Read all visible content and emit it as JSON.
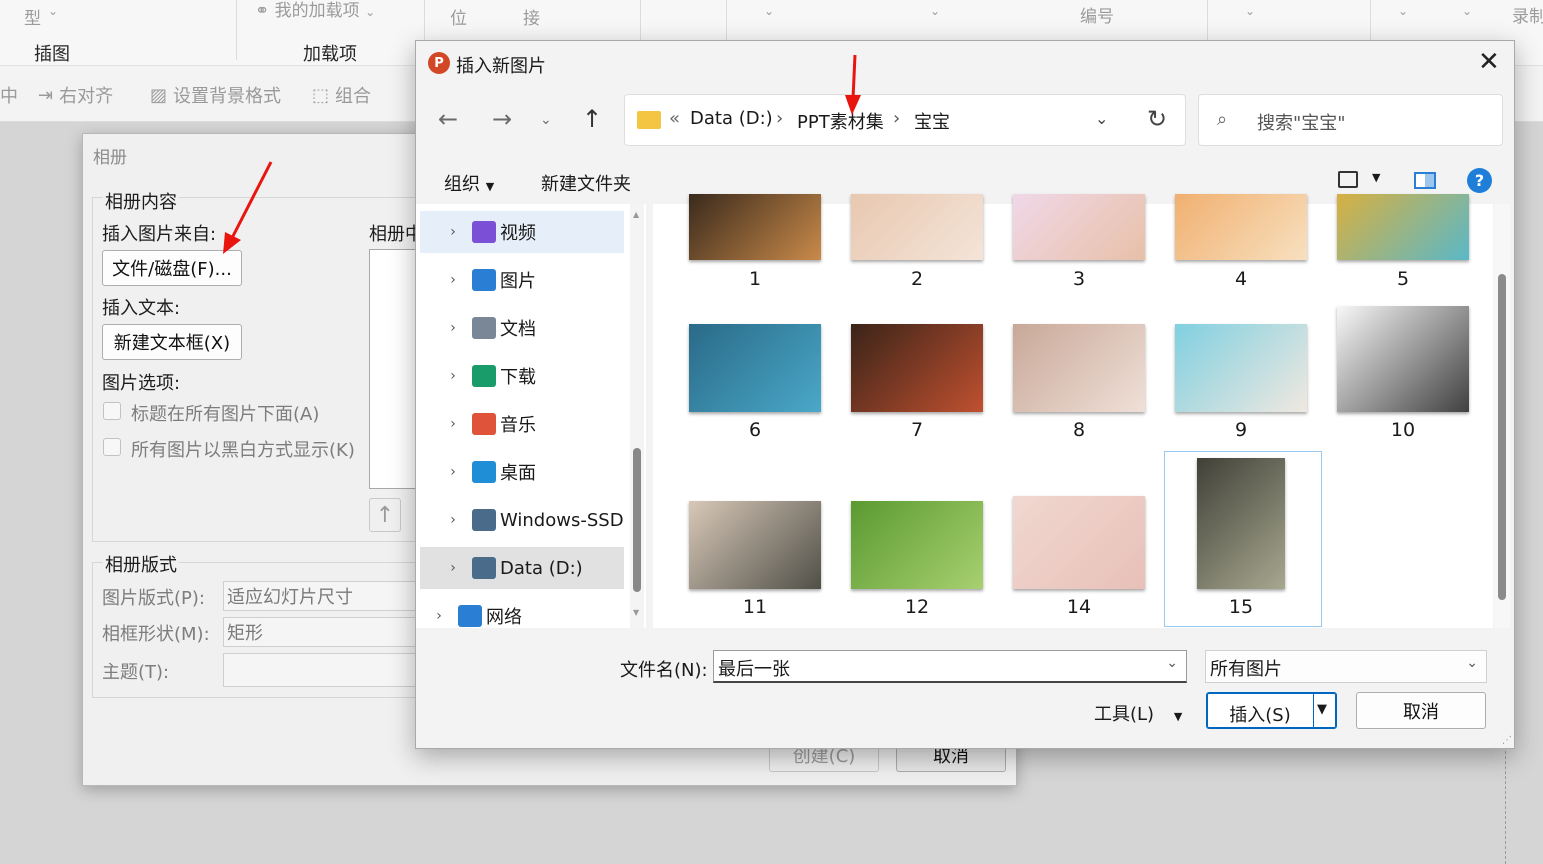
{
  "ribbon": {
    "top_faded": [
      "型",
      "我的加载项",
      "位",
      "接",
      "编号",
      "录制"
    ],
    "groups": {
      "insert_graphic": "插图",
      "addins": "加载项"
    },
    "toolbar": {
      "cut_partial": "中",
      "align_right": "右对齐",
      "bg_format": "设置背景格式",
      "group": "组合"
    }
  },
  "album_dialog": {
    "title": "相册",
    "content_group": "相册内容",
    "insert_from": "插入图片来自:",
    "file_disk_button": "文件/磁盘(F)...",
    "insert_text": "插入文本:",
    "new_textbox_button": "新建文本框(X)",
    "picture_options": "图片选项:",
    "option_caption": "标题在所有图片下面(A)",
    "option_bw": "所有图片以黑白方式显示(K)",
    "pictures_in_album": "相册中",
    "layout_group": "相册版式",
    "picture_layout_label": "图片版式(P):",
    "picture_layout_value": "适应幻灯片尺寸",
    "frame_shape_label": "相框形状(M):",
    "frame_shape_value": "矩形",
    "theme_label": "主题(T):",
    "theme_value": "",
    "create_button": "创建(C)",
    "cancel_button": "取消"
  },
  "file_dialog": {
    "title": "插入新图片",
    "breadcrumb": [
      "Data (D:)",
      "PPT素材集",
      "宝宝"
    ],
    "breadcrumb_prefix": "«",
    "search_placeholder": "搜索\"宝宝\"",
    "organize": "组织",
    "new_folder": "新建文件夹",
    "tree": [
      {
        "label": "视频",
        "icon": "video-folder-icon",
        "color": "#7b4fd6"
      },
      {
        "label": "图片",
        "icon": "pictures-folder-icon",
        "color": "#2a7fd4"
      },
      {
        "label": "文档",
        "icon": "documents-folder-icon",
        "color": "#7a8797"
      },
      {
        "label": "下载",
        "icon": "downloads-folder-icon",
        "color": "#1a9c6a"
      },
      {
        "label": "音乐",
        "icon": "music-folder-icon",
        "color": "#e0533b"
      },
      {
        "label": "桌面",
        "icon": "desktop-folder-icon",
        "color": "#1f8ed6"
      },
      {
        "label": "Windows-SSD",
        "icon": "drive-icon",
        "color": "#4a6b8a"
      },
      {
        "label": "Data (D:)",
        "icon": "drive-icon",
        "color": "#4a6b8a"
      },
      {
        "label": "网络",
        "icon": "network-icon",
        "color": "#2a7fd4"
      }
    ],
    "files": [
      {
        "name": "1",
        "colors": [
          "#3a2a1c",
          "#c98a4a"
        ]
      },
      {
        "name": "2",
        "colors": [
          "#e8c8b0",
          "#f4e4d8"
        ]
      },
      {
        "name": "3",
        "colors": [
          "#f0d8e8",
          "#e8c0a8"
        ]
      },
      {
        "name": "4",
        "colors": [
          "#f0b070",
          "#f8e0c0"
        ]
      },
      {
        "name": "5",
        "colors": [
          "#d8b040",
          "#5ab8c8"
        ]
      },
      {
        "name": "6",
        "colors": [
          "#2a6a88",
          "#4aa8c8"
        ]
      },
      {
        "name": "7",
        "colors": [
          "#3a2418",
          "#c05030"
        ]
      },
      {
        "name": "8",
        "colors": [
          "#c8a898",
          "#f0e0d8"
        ]
      },
      {
        "name": "9",
        "colors": [
          "#80d0e0",
          "#f0e8e0"
        ]
      },
      {
        "name": "10",
        "colors": [
          "#f8f8f8",
          "#404040"
        ]
      },
      {
        "name": "11",
        "colors": [
          "#d8c8b8",
          "#505048"
        ]
      },
      {
        "name": "12",
        "colors": [
          "#5a9a30",
          "#a8d070"
        ]
      },
      {
        "name": "14",
        "colors": [
          "#f0d8d0",
          "#e8c0b8"
        ]
      },
      {
        "name": "15",
        "colors": [
          "#404038",
          "#a8a890"
        ]
      }
    ],
    "filename_label": "文件名(N):",
    "filename_value": "最后一张",
    "filetype_value": "所有图片",
    "tools": "工具(L)",
    "insert_button": "插入(S)",
    "cancel_button": "取消"
  }
}
